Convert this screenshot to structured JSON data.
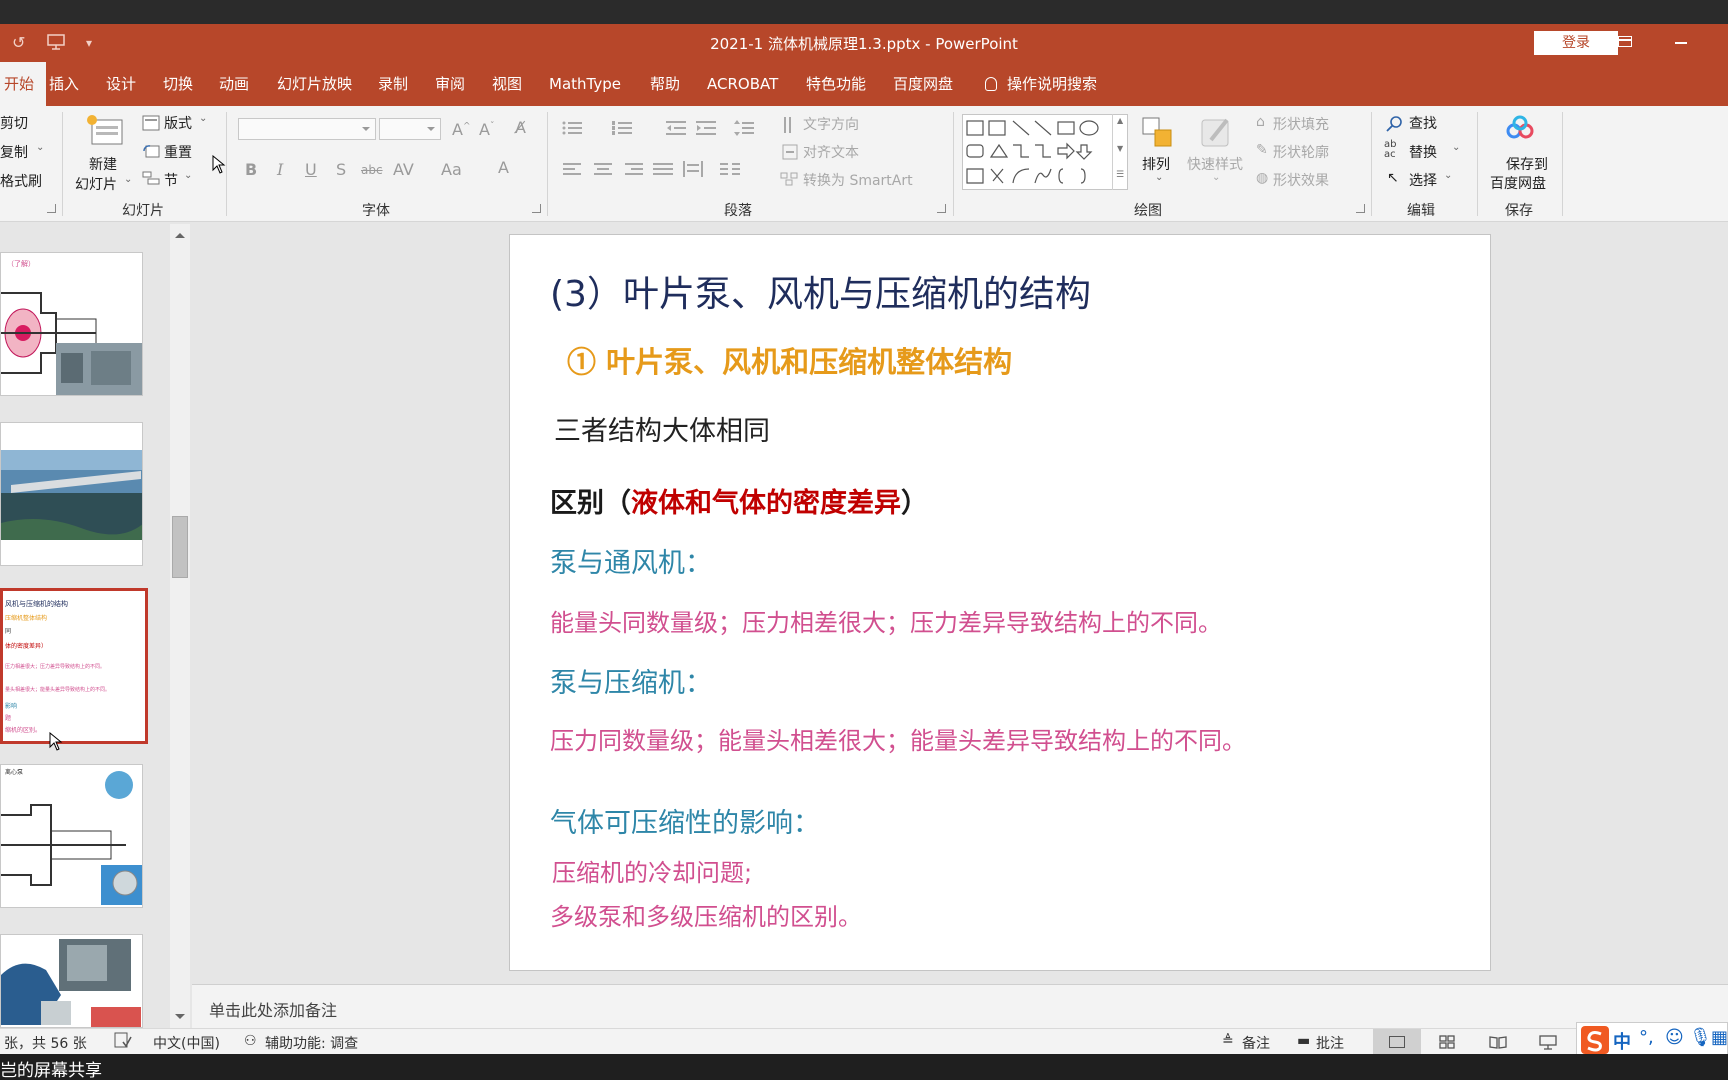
{
  "window": {
    "title": "2021-1 流体机械原理1.3.pptx  -  PowerPoint",
    "login_label": "登录"
  },
  "menu": {
    "tabs": [
      "开始",
      "插入",
      "设计",
      "切换",
      "动画",
      "幻灯片放映",
      "录制",
      "审阅",
      "视图",
      "MathType",
      "帮助",
      "ACROBAT",
      "特色功能",
      "百度网盘"
    ],
    "active_tab": "开始",
    "tell_me": "操作说明搜索"
  },
  "ribbon": {
    "clipboard": {
      "cut": "剪切",
      "copy": "复制",
      "format_painter": "格式刷"
    },
    "slides": {
      "group_label": "幻灯片",
      "new_slide_line1": "新建",
      "new_slide_line2": "幻灯片",
      "layout": "版式",
      "reset": "重置",
      "section": "节"
    },
    "font": {
      "group_label": "字体",
      "font_name_value": "",
      "font_size_value": "",
      "change_case": "Aa"
    },
    "paragraph": {
      "group_label": "段落",
      "text_direction": "文字方向",
      "align_text": "对齐文本",
      "convert_smartart": "转换为 SmartArt"
    },
    "drawing": {
      "group_label": "绘图",
      "arrange": "排列",
      "quick_styles": "快速样式",
      "shape_fill": "形状填充",
      "shape_outline": "形状轮廓",
      "shape_effects": "形状效果"
    },
    "editing": {
      "group_label": "编辑",
      "find": "查找",
      "replace": "替换",
      "select": "选择"
    },
    "save": {
      "group_label": "保存",
      "save_line1": "保存到",
      "save_line2": "百度网盘"
    }
  },
  "thumbnails": {
    "slide1_caption": "（了解）",
    "slide3_lines": [
      "风机与压缩机的结构",
      "压缩机整体结构",
      "同",
      "体的密度差异）",
      "压力相差很大；压力差异导致结构上的不同。",
      "量头相差很大；能量头差异导致结构上的不同。",
      "影响",
      "题",
      "缩机的区别。"
    ],
    "slide4_label": "离心泵"
  },
  "slide": {
    "title": "(3）叶片泵、风机与压缩机的结构",
    "subtitle": "①  叶片泵、风机和压缩机整体结构",
    "intro": "三者结构大体相同",
    "diff_prefix": "区别（",
    "diff_highlight": "液体和气体的密度差异",
    "diff_suffix": "）",
    "pump_fan_heading": "泵与通风机：",
    "pump_fan_text": "能量头同数量级；压力相差很大；压力差异导致结构上的不同。",
    "pump_comp_heading": "泵与压缩机：",
    "pump_comp_text": "压力同数量级；能量头相差很大；能量头差异导致结构上的不同。",
    "compress_heading": "气体可压缩性的影响：",
    "compress_line1": "压缩机的冷却问题;",
    "compress_line2": "多级泵和多级压缩机的区别。",
    "colors": {
      "title": "#1f2d5c",
      "subtitle": "#e69a1a",
      "intro": "#222222",
      "diff_black": "#1a1a1a",
      "diff_red": "#c00000",
      "teal": "#2e86a8",
      "magenta": "#d14f8f"
    }
  },
  "notes": {
    "placeholder": "单击此处添加备注"
  },
  "status": {
    "slide_count": "张，共 56 张",
    "language": "中文(中国)",
    "accessibility": "辅助功能: 调查",
    "notes_btn": "备注",
    "comments_btn": "批注"
  },
  "ime": {
    "mode": "中"
  },
  "share_banner": "岂的屏幕共享"
}
